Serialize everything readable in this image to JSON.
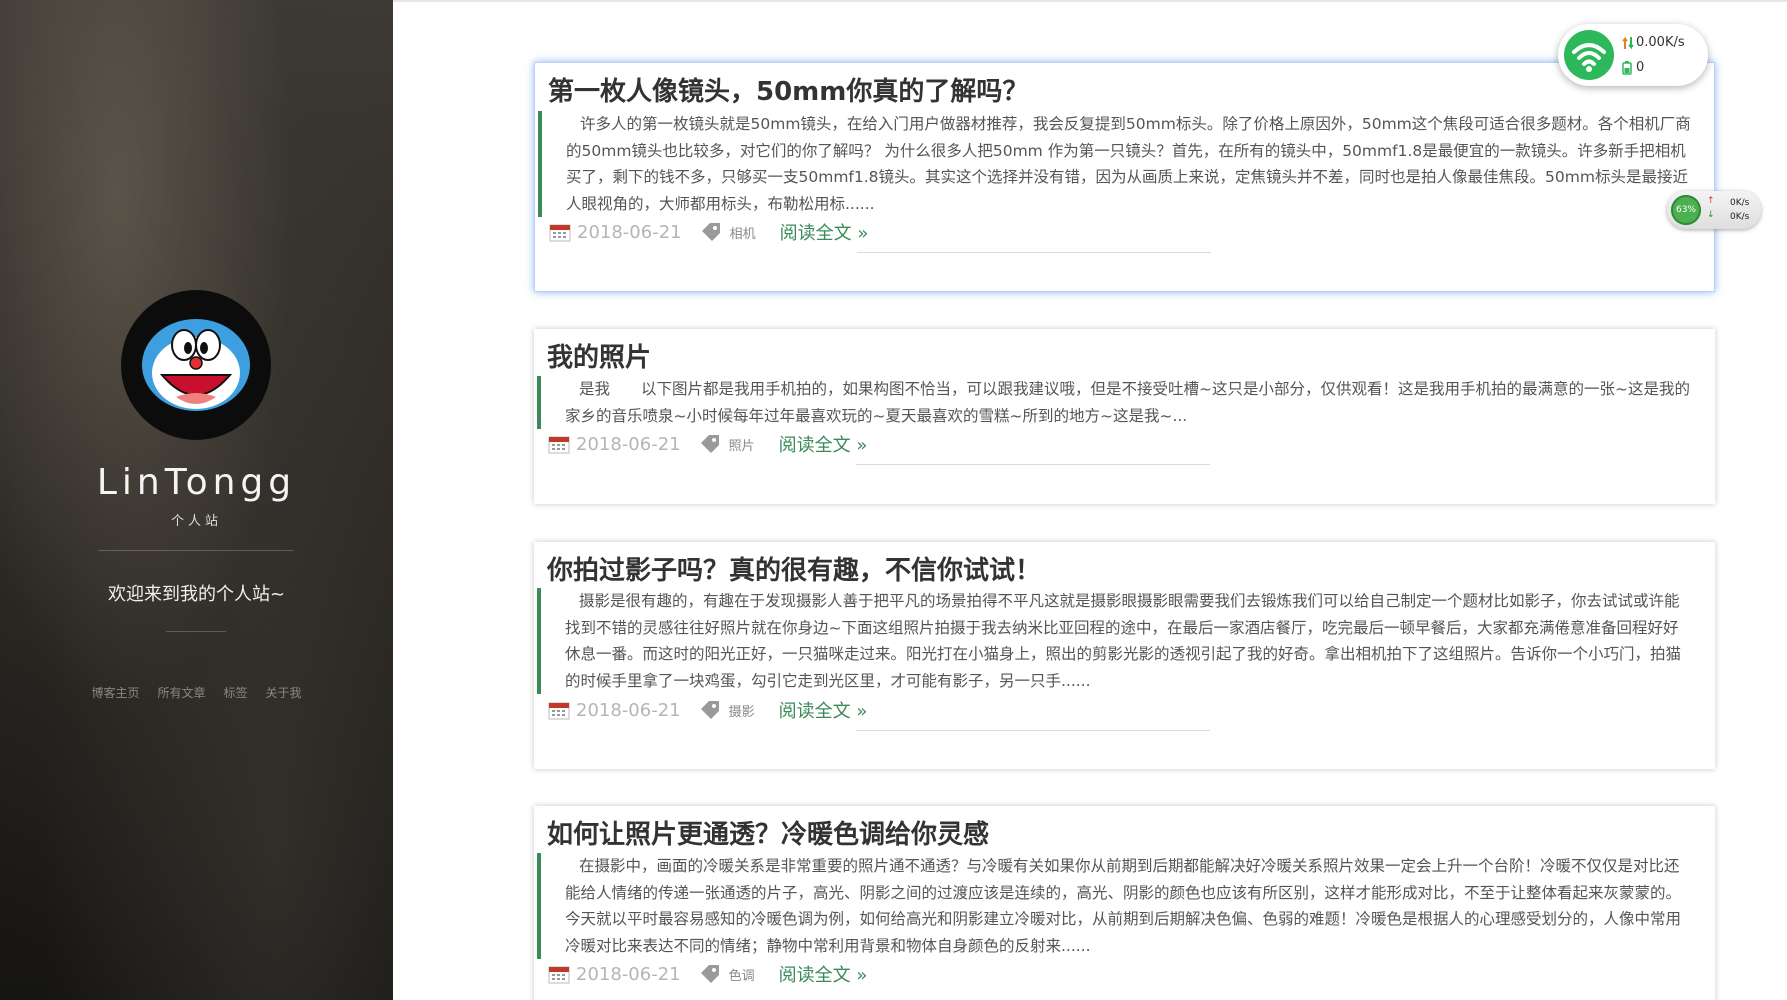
{
  "sidebar": {
    "site_name": "LinTongg",
    "site_sub": "个人站",
    "welcome": "欢迎来到我的个人站~",
    "nav": [
      {
        "label": "博客主页"
      },
      {
        "label": "所有文章"
      },
      {
        "label": "标签"
      },
      {
        "label": "关于我"
      }
    ]
  },
  "posts": [
    {
      "title": "第一枚人像镜头，50mm你真的了解吗？",
      "excerpt": "许多人的第一枚镜头就是50mm镜头，在给入门用户做器材推荐，我会反复提到50mm标头。除了价格上原因外，50mm这个焦段可适合很多题材。各个相机厂商的50mm镜头也比较多，对它们的你了解吗？ 为什么很多人把50mm 作为第一只镜头？首先，在所有的镜头中，50mmf1.8是最便宜的一款镜头。许多新手把相机买了，剩下的钱不多，只够买一支50mmf1.8镜头。其实这个选择并没有错，因为从画质上来说，定焦镜头并不差，同时也是拍人像最佳焦段。50mm标头是最接近人眼视角的，大师都用标头，布勒松用标......",
      "date": "2018-06-21",
      "tag": "相机",
      "read_more": "阅读全文 »"
    },
    {
      "title": "我的照片",
      "excerpt": "是我　　以下图片都是我用手机拍的，如果构图不恰当，可以跟我建议哦，但是不接受吐槽~这只是小部分，仅供观看！这是我用手机拍的最满意的一张~这是我的家乡的音乐喷泉~小时候每年过年最喜欢玩的~夏天最喜欢的雪糕~所到的地方~这是我~...",
      "date": "2018-06-21",
      "tag": "照片",
      "read_more": "阅读全文 »"
    },
    {
      "title": "你拍过影子吗？真的很有趣，不信你试试！",
      "excerpt": "摄影是很有趣的，有趣在于发现摄影人善于把平凡的场景拍得不平凡这就是摄影眼摄影眼需要我们去锻炼我们可以给自己制定一个题材比如影子，你去试试或许能找到不错的灵感往往好照片就在你身边~下面这组照片拍摄于我去纳米比亚回程的途中，在最后一家酒店餐厅，吃完最后一顿早餐后，大家都充满倦意准备回程好好休息一番。而这时的阳光正好，一只猫咪走过来。阳光打在小猫身上，照出的剪影光影的透视引起了我的好奇。拿出相机拍下了这组照片。告诉你一个小巧门，拍猫的时候手里拿了一块鸡蛋，勾引它走到光区里，才可能有影子，另一只手......",
      "date": "2018-06-21",
      "tag": "摄影",
      "read_more": "阅读全文 »"
    },
    {
      "title": "如何让照片更通透？冷暖色调给你灵感",
      "excerpt": "在摄影中，画面的冷暖关系是非常重要的照片通不通透？与冷暖有关如果你从前期到后期都能解决好冷暖关系照片效果一定会上升一个台阶！冷暖不仅仅是对比还能给人情绪的传递一张通透的片子，高光、阴影之间的过渡应该是连续的，高光、阴影的颜色也应该有所区别，这样才能形成对比，不至于让整体看起来灰蒙蒙的。今天就以平时最容易感知的冷暖色调为例，如何给高光和阴影建立冷暖对比，从前期到后期解决色偏、色弱的难题！冷暖色是根据人的心理感受划分的，人像中常用冷暖对比来表达不同的情绪；静物中常利用背景和物体自身颜色的反射来......",
      "date": "2018-06-21",
      "tag": "色调",
      "read_more": "阅读全文 »"
    }
  ],
  "net_widget": {
    "speed": "0.00K/s",
    "count": "0"
  },
  "mini_widget": {
    "percent": "63%",
    "up": "0K/s",
    "down": "0K/s"
  },
  "colors": {
    "accent": "#3b8a5a",
    "date": "#b5b5b5"
  }
}
